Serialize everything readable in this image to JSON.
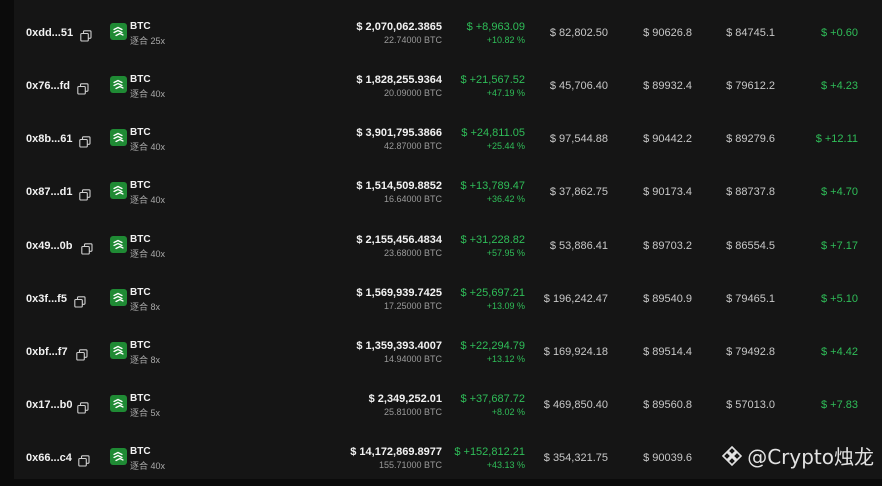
{
  "coin_icon": "btc-coin-icon",
  "copy_icon": "copy-icon",
  "colors": {
    "positive": "#2fbd58",
    "coin_badge": "#1f8a34",
    "background": "#151515"
  },
  "rows": [
    {
      "address": "0xdd...51",
      "coin": "BTC",
      "leverage": "逐合 25x",
      "size_usd": "$ 2,070,062.3865",
      "size_btc": "22.74000 BTC",
      "pnl": "$ +8,963.09",
      "pnl_pct": "+10.82 %",
      "margin": "$ 82,802.50",
      "entry": "$ 90626.8",
      "liq": "$ 84745.1",
      "funding": "$ +0.60"
    },
    {
      "address": "0x76...fd",
      "coin": "BTC",
      "leverage": "逐合 40x",
      "size_usd": "$ 1,828,255.9364",
      "size_btc": "20.09000 BTC",
      "pnl": "$ +21,567.52",
      "pnl_pct": "+47.19 %",
      "margin": "$ 45,706.40",
      "entry": "$ 89932.4",
      "liq": "$ 79612.2",
      "funding": "$ +4.23"
    },
    {
      "address": "0x8b...61",
      "coin": "BTC",
      "leverage": "逐合 40x",
      "size_usd": "$ 3,901,795.3866",
      "size_btc": "42.87000 BTC",
      "pnl": "$ +24,811.05",
      "pnl_pct": "+25.44 %",
      "margin": "$ 97,544.88",
      "entry": "$ 90442.2",
      "liq": "$ 89279.6",
      "funding": "$ +12.11"
    },
    {
      "address": "0x87...d1",
      "coin": "BTC",
      "leverage": "逐合 40x",
      "size_usd": "$ 1,514,509.8852",
      "size_btc": "16.64000 BTC",
      "pnl": "$ +13,789.47",
      "pnl_pct": "+36.42 %",
      "margin": "$ 37,862.75",
      "entry": "$ 90173.4",
      "liq": "$ 88737.8",
      "funding": "$ +4.70"
    },
    {
      "address": "0x49...0b",
      "coin": "BTC",
      "leverage": "逐合 40x",
      "size_usd": "$ 2,155,456.4834",
      "size_btc": "23.68000 BTC",
      "pnl": "$ +31,228.82",
      "pnl_pct": "+57.95 %",
      "margin": "$ 53,886.41",
      "entry": "$ 89703.2",
      "liq": "$ 86554.5",
      "funding": "$ +7.17"
    },
    {
      "address": "0x3f...f5",
      "coin": "BTC",
      "leverage": "逐合 8x",
      "size_usd": "$ 1,569,939.7425",
      "size_btc": "17.25000 BTC",
      "pnl": "$ +25,697.21",
      "pnl_pct": "+13.09 %",
      "margin": "$ 196,242.47",
      "entry": "$ 89540.9",
      "liq": "$ 79465.1",
      "funding": "$ +5.10"
    },
    {
      "address": "0xbf...f7",
      "coin": "BTC",
      "leverage": "逐合 8x",
      "size_usd": "$ 1,359,393.4007",
      "size_btc": "14.94000 BTC",
      "pnl": "$ +22,294.79",
      "pnl_pct": "+13.12 %",
      "margin": "$ 169,924.18",
      "entry": "$ 89514.4",
      "liq": "$ 79492.8",
      "funding": "$ +4.42"
    },
    {
      "address": "0x17...b0",
      "coin": "BTC",
      "leverage": "逐合 5x",
      "size_usd": "$ 2,349,252.01",
      "size_btc": "25.81000 BTC",
      "pnl": "$ +37,687.72",
      "pnl_pct": "+8.02 %",
      "margin": "$ 469,850.40",
      "entry": "$ 89560.8",
      "liq": "$ 57013.0",
      "funding": "$ +7.83"
    },
    {
      "address": "0x66...c4",
      "coin": "BTC",
      "leverage": "逐合 40x",
      "size_usd": "$ 14,172,869.8977",
      "size_btc": "155.71000 BTC",
      "pnl": "$ +152,812.21",
      "pnl_pct": "+43.13 %",
      "margin": "$ 354,321.75",
      "entry": "$ 90039.6",
      "liq": "",
      "funding": ""
    }
  ],
  "watermark": {
    "text": "@Crypto烛龙",
    "logo_icon": "binance-diamond-logo-icon"
  }
}
